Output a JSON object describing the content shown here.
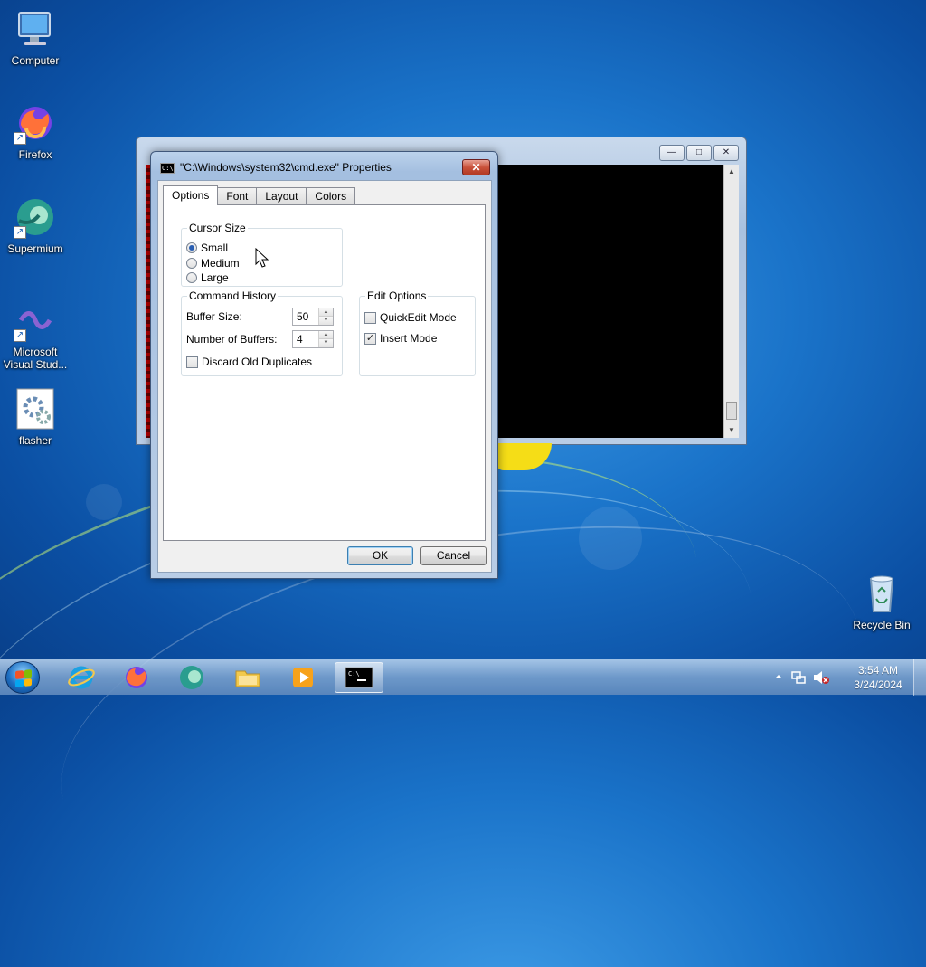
{
  "desktop": {
    "icons": [
      {
        "label": "Computer",
        "icon": "computer-icon"
      },
      {
        "label": "Firefox",
        "icon": "firefox-icon"
      },
      {
        "label": "Supermium",
        "icon": "supermium-icon"
      },
      {
        "label": "Microsoft Visual Stud...",
        "icon": "visual-studio-icon"
      },
      {
        "label": "flasher",
        "icon": "flasher-icon"
      },
      {
        "label": "Recycle Bin",
        "icon": "recycle-bin-icon"
      }
    ]
  },
  "background_window": {
    "cap_min": "—",
    "cap_max": "□",
    "cap_close": "✕"
  },
  "dialog": {
    "title": "\"C:\\Windows\\system32\\cmd.exe\" Properties",
    "title_icon_text": "C:\\",
    "close_glyph": "✕",
    "tabs": [
      {
        "label": "Options",
        "active": true
      },
      {
        "label": "Font",
        "active": false
      },
      {
        "label": "Layout",
        "active": false
      },
      {
        "label": "Colors",
        "active": false
      }
    ],
    "cursor_size": {
      "title": "Cursor Size",
      "options": [
        {
          "label": "Small",
          "selected": true
        },
        {
          "label": "Medium",
          "selected": false
        },
        {
          "label": "Large",
          "selected": false
        }
      ]
    },
    "command_history": {
      "title": "Command History",
      "buffer_size_label": "Buffer Size:",
      "buffer_size_value": "50",
      "num_buffers_label": "Number of Buffers:",
      "num_buffers_value": "4",
      "discard_label": "Discard Old Duplicates",
      "discard_checked": false
    },
    "edit_options": {
      "title": "Edit Options",
      "quickedit_label": "QuickEdit Mode",
      "quickedit_checked": false,
      "insert_label": "Insert Mode",
      "insert_checked": true
    },
    "ok_label": "OK",
    "cancel_label": "Cancel"
  },
  "taskbar": {
    "items": [
      "internet-explorer-icon",
      "firefox-icon",
      "supermium-icon",
      "file-explorer-icon",
      "media-player-icon",
      "cmd-icon"
    ],
    "time": "3:54 AM",
    "date": "3/24/2024",
    "tray_icons": [
      "show-hidden-icons-icon",
      "network-icon",
      "volume-muted-icon"
    ]
  },
  "colors": {
    "desktop_blue": "#1a73c9",
    "dialog_frame": "#a4bfe0",
    "close_red": "#c9513a"
  }
}
